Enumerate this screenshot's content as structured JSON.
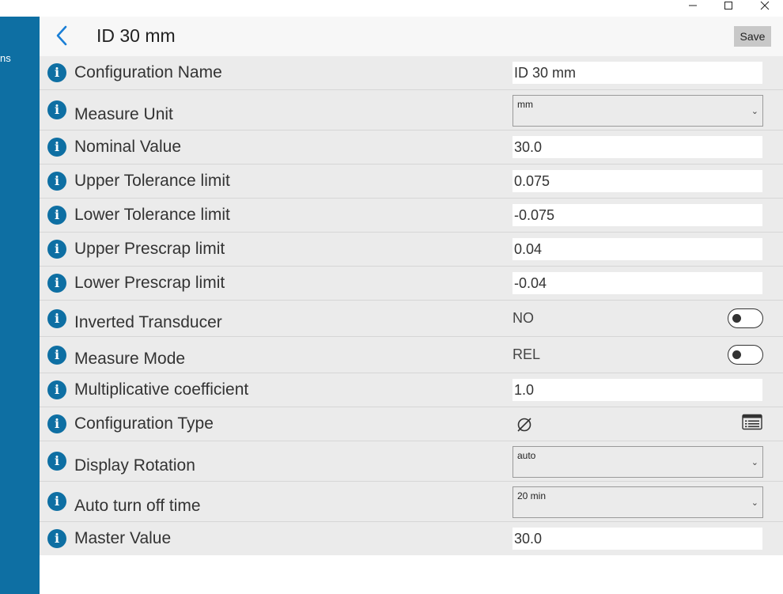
{
  "window": {
    "minimize_icon": "minimize-icon",
    "maximize_icon": "maximize-icon",
    "close_icon": "close-icon"
  },
  "sidebar": {
    "partial_label": "ns",
    "color": "#0e6fa3"
  },
  "header": {
    "back_icon": "chevron-left-icon",
    "title": "ID 30 mm",
    "save_label": "Save"
  },
  "rows": [
    {
      "label": "Configuration Name",
      "type": "text",
      "value": "ID 30 mm"
    },
    {
      "label": "Measure Unit",
      "type": "select",
      "value": "mm"
    },
    {
      "label": "Nominal Value",
      "type": "text",
      "value": "30.0"
    },
    {
      "label": "Upper Tolerance limit",
      "type": "text",
      "value": "0.075"
    },
    {
      "label": "Lower Tolerance limit",
      "type": "text",
      "value": "-0.075"
    },
    {
      "label": "Upper Prescrap limit",
      "type": "text",
      "value": "0.04"
    },
    {
      "label": "Lower Prescrap limit",
      "type": "text",
      "value": "-0.04"
    },
    {
      "label": "Inverted Transducer",
      "type": "toggle",
      "value": "NO",
      "on": false
    },
    {
      "label": "Measure Mode",
      "type": "toggle",
      "value": "REL",
      "on": false
    },
    {
      "label": "Multiplicative coefficient",
      "type": "text",
      "value": "1.0"
    },
    {
      "label": "Configuration Type",
      "type": "icon",
      "value_icon": "diameter-icon",
      "action_icon": "list-icon"
    },
    {
      "label": "Display Rotation",
      "type": "select",
      "value": "auto"
    },
    {
      "label": "Auto turn off time",
      "type": "select",
      "value": "20 min"
    },
    {
      "label": "Master Value",
      "type": "text",
      "value": "30.0"
    }
  ],
  "info_glyph": "i",
  "colors": {
    "accent": "#0e6fa3",
    "back_chevron": "#1a7fd6",
    "row_background": "#ebebeb"
  }
}
